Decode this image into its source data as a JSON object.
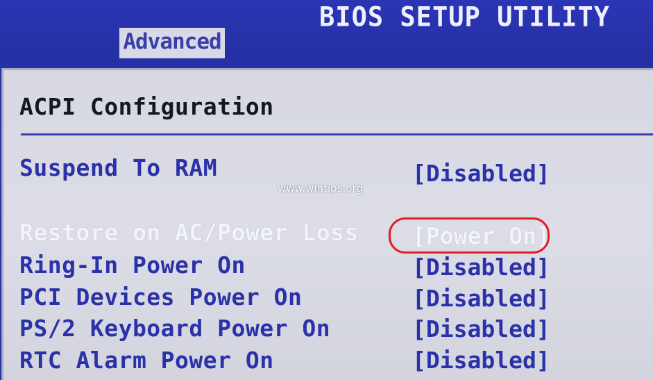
{
  "header": {
    "title": "BIOS SETUP UTILITY",
    "active_tab": "Advanced"
  },
  "panel": {
    "heading": "ACPI Configuration",
    "options": [
      {
        "label": "Suspend To RAM",
        "value": "[Disabled]"
      },
      {
        "label": "Restore on AC/Power Loss",
        "value": "[Power On]"
      },
      {
        "label": "Ring-In Power On",
        "value": "[Disabled]"
      },
      {
        "label": "PCI Devices Power On",
        "value": "[Disabled]"
      },
      {
        "label": "PS/2 Keyboard Power On",
        "value": "[Disabled]"
      },
      {
        "label": "RTC Alarm Power On",
        "value": "[Disabled]"
      }
    ]
  },
  "watermark": "www.wintips.org",
  "colors": {
    "bios_blue": "#2830a8",
    "panel_gray": "#d8d9e6",
    "selected_text": "#f3f4fb",
    "highlight_ring": "#e01e2a"
  }
}
